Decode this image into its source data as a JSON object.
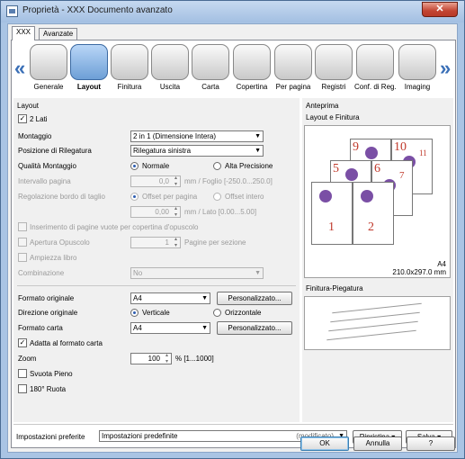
{
  "window": {
    "title": "Proprietà - XXX Documento avanzato",
    "close_glyph": "✕"
  },
  "tabs": [
    {
      "label": "XXX"
    },
    {
      "label": "Avanzate"
    }
  ],
  "toolbar": {
    "prev_arrow": "«",
    "next_arrow": "»",
    "items": [
      {
        "label": "Generale",
        "icon": "general-icon"
      },
      {
        "label": "Layout",
        "icon": "layout-icon"
      },
      {
        "label": "Finitura",
        "icon": "finishing-icon"
      },
      {
        "label": "Uscita",
        "icon": "output-icon"
      },
      {
        "label": "Carta",
        "icon": "paper-icon"
      },
      {
        "label": "Copertina",
        "icon": "cover-icon"
      },
      {
        "label": "Per pagina",
        "icon": "per-page-icon"
      },
      {
        "label": "Registri",
        "icon": "tabs-icon"
      },
      {
        "label": "Conf. di Reg.",
        "icon": "save-settings-icon"
      },
      {
        "label": "Imaging",
        "icon": "imaging-icon"
      }
    ],
    "selected": "Layout"
  },
  "layout": {
    "section_label": "Layout",
    "due_lati": {
      "label": "2 Lati",
      "checked": true
    },
    "montaggio": {
      "label": "Montaggio",
      "value": "2 in 1 (Dimensione Intera)"
    },
    "rilegatura": {
      "label": "Posizione di Rilegatura",
      "value": "Rilegatura sinistra"
    },
    "qualita": {
      "label": "Qualità Montaggio",
      "opt1": "Normale",
      "opt2": "Alta Precisione"
    },
    "intervallo": {
      "label": "Intervallo pagina",
      "value": "0,0",
      "unit": "mm / Foglio [-250.0...250.0]"
    },
    "regolazione": {
      "label": "Regolazione bordo di taglio",
      "opt1": "Offset per pagina",
      "opt2": "Offset intero",
      "value": "0,00",
      "unit": "mm / Lato [0.00...5.00]"
    },
    "inserimento": {
      "label": "Inserimento di pagine vuote per copertina d'opuscolo"
    },
    "apertura": {
      "label": "Apertura Opuscolo",
      "value": "1",
      "unit": "Pagine per sezione"
    },
    "ampiezza": {
      "label": "Ampiezza libro"
    },
    "combinazione": {
      "label": "Combinazione",
      "value": "No"
    }
  },
  "format": {
    "originale": {
      "label": "Formato originale",
      "value": "A4",
      "button": "Personalizzato..."
    },
    "direzione": {
      "label": "Direzione originale",
      "opt1": "Verticale",
      "opt2": "Orizzontale"
    },
    "carta": {
      "label": "Formato carta",
      "value": "A4",
      "button": "Personalizzato..."
    },
    "adatta": {
      "label": "Adatta al formato carta",
      "checked": true
    },
    "zoom": {
      "label": "Zoom",
      "value": "100",
      "unit": "% [1...1000]"
    },
    "svuota": {
      "label": "Svuota Pieno"
    },
    "ruota": {
      "label": "180° Ruota"
    }
  },
  "preview": {
    "title": "Anteprima",
    "subtitle": "Layout e Finitura",
    "paper": "A4",
    "dims": "210.0x297.0 mm",
    "pages": [
      "9",
      "10",
      "11",
      "5",
      "6",
      "7",
      "1",
      "2"
    ],
    "folding_label": "Finitura-Piegatura"
  },
  "bottom": {
    "favorites_label": "Impostazioni preferite",
    "favorites_value": "Impostazioni predefinite",
    "modified": "(modificato)",
    "restore": "Ripristina",
    "save": "Salva",
    "ok": "OK",
    "cancel": "Annulla",
    "help": "?"
  }
}
